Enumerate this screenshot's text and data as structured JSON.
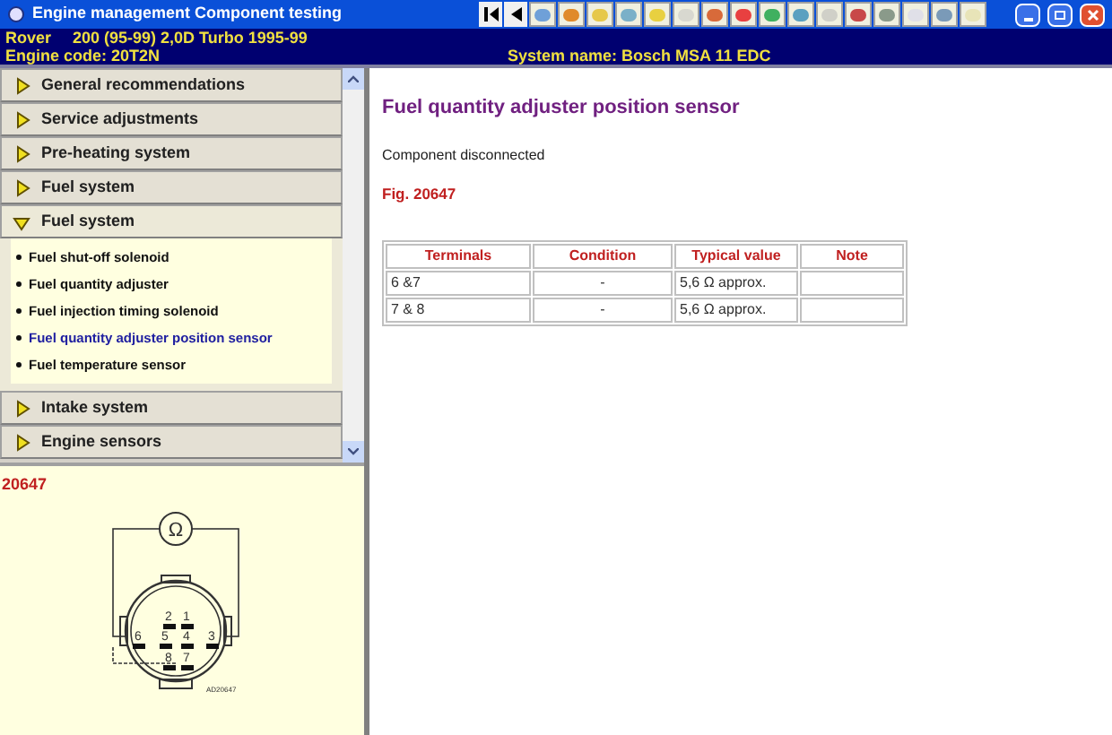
{
  "window": {
    "title": "Engine management Component testing"
  },
  "vehicle": {
    "make": "Rover",
    "model": "200 (95-99) 2,0D Turbo 1995-99",
    "engine_code": "Engine code: 20T2N",
    "system_name": "System name: Bosch MSA 11 EDC"
  },
  "menu": [
    {
      "label": "General recommendations",
      "expanded": false
    },
    {
      "label": "Service adjustments",
      "expanded": false
    },
    {
      "label": "Pre-heating system",
      "expanded": false
    },
    {
      "label": "Fuel system",
      "expanded": false
    },
    {
      "label": "Fuel system",
      "expanded": true,
      "children": [
        {
          "label": "Fuel shut-off solenoid",
          "selected": false
        },
        {
          "label": "Fuel quantity adjuster",
          "selected": false
        },
        {
          "label": "Fuel injection timing solenoid",
          "selected": false
        },
        {
          "label": "Fuel quantity adjuster position sensor",
          "selected": true
        },
        {
          "label": "Fuel temperature sensor",
          "selected": false
        }
      ]
    },
    {
      "label": "Intake system",
      "expanded": false
    },
    {
      "label": "Engine sensors",
      "expanded": false
    }
  ],
  "figure": {
    "caption": "20647",
    "meter_symbol": "Ω",
    "pin_labels": [
      "2",
      "1",
      "6",
      "5",
      "4",
      "3",
      "8",
      "7"
    ],
    "code": "AD20647"
  },
  "content": {
    "title": "Fuel quantity adjuster position sensor",
    "note": "Component disconnected",
    "figure_ref": "Fig. 20647",
    "table": {
      "columns": [
        "Terminals",
        "Condition",
        "Typical value",
        "Note"
      ],
      "rows": [
        [
          "6 &7",
          "-",
          "5,6 Ω approx.",
          ""
        ],
        [
          "7 & 8",
          "-",
          "5,6 Ω approx.",
          ""
        ]
      ]
    }
  }
}
